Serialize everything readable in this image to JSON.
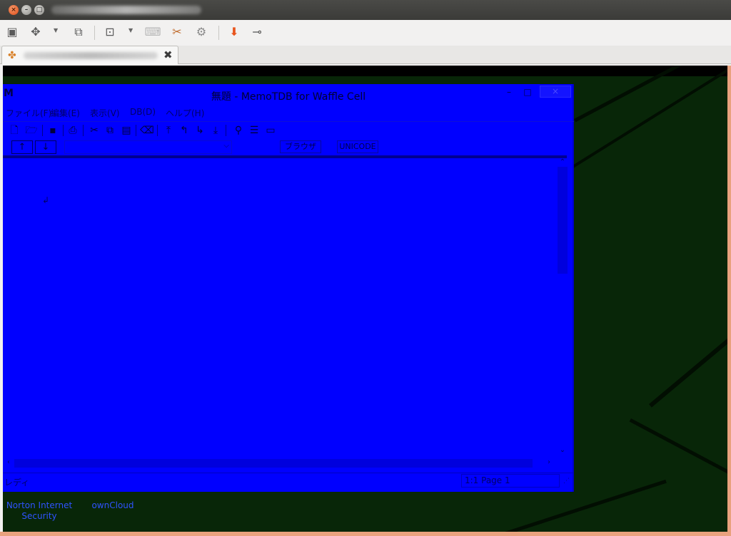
{
  "host": {
    "window_buttons": [
      "close",
      "minimize",
      "maximize"
    ],
    "toolbar_icons": [
      "screen-1-icon",
      "fit-screen-icon",
      "windows-icon",
      "zoom-icon",
      "keyboard-icon",
      "tools-icon",
      "settings-gears-icon",
      "download-icon",
      "disconnect-plug-icon"
    ],
    "tab_close": "✖"
  },
  "app": {
    "logo": "M",
    "title": "無題 - MemoTDB for Waffle Cell",
    "min_label": "–",
    "max_label": "□",
    "close_label": "×",
    "menu": [
      {
        "label": "ファイル(F)"
      },
      {
        "label": "編集(E)"
      },
      {
        "label": "表示(V)"
      },
      {
        "label": "DB(D)"
      },
      {
        "label": "ヘルプ(H)"
      }
    ],
    "nav": {
      "up": "↑",
      "down": "↓",
      "combo_value": "",
      "browser_label": "ブラウザ",
      "encoding_label": "UNICODE"
    },
    "editor": {
      "line_end_mark": "↲"
    },
    "status": {
      "left": "レディ",
      "right": "1:1 Page 1"
    }
  },
  "desktop": {
    "icons": [
      {
        "label": "Norton Internet Security"
      },
      {
        "label": "ownCloud"
      }
    ]
  },
  "colors": {
    "app_bg": "#0000ff",
    "desktop_bg": "#082608",
    "host_chrome": "#f2f1f0"
  }
}
